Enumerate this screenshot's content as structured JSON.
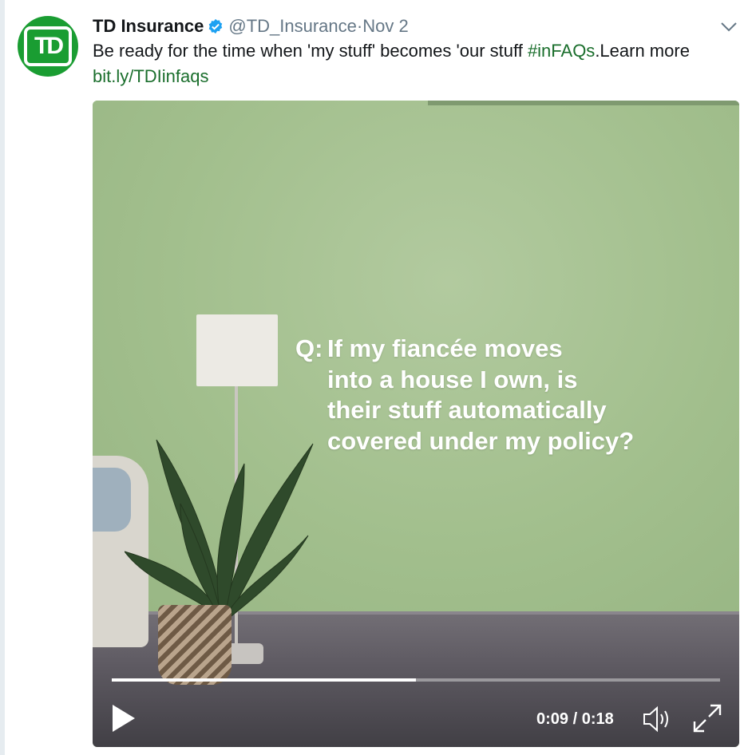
{
  "tweet": {
    "display_name": "TD Insurance",
    "handle": "@TD_Insurance",
    "date": "·Nov 2",
    "avatar_text": "TD",
    "text_main": "Be ready for the time when 'my stuff' becomes 'our stuff ",
    "hashtag": "#inFAQs",
    "text_after_hashtag": ".Learn more",
    "link": "bit.ly/TDIinfaqs"
  },
  "video": {
    "question_prefix": "Q:",
    "question_lines": [
      "If my fiancée moves",
      "into a house I own, is",
      "their stuff automatically",
      "covered under my policy?"
    ],
    "current_time": "0:09",
    "separator": "/",
    "duration": "0:18",
    "progress": 0.5
  },
  "colors": {
    "brand_green": "#1a9d32",
    "link_green": "#1a6e2c",
    "verified_blue": "#1da1f2"
  },
  "icons": [
    "verified-badge-icon",
    "chevron-down-icon",
    "play-icon",
    "volume-icon",
    "fullscreen-icon"
  ]
}
